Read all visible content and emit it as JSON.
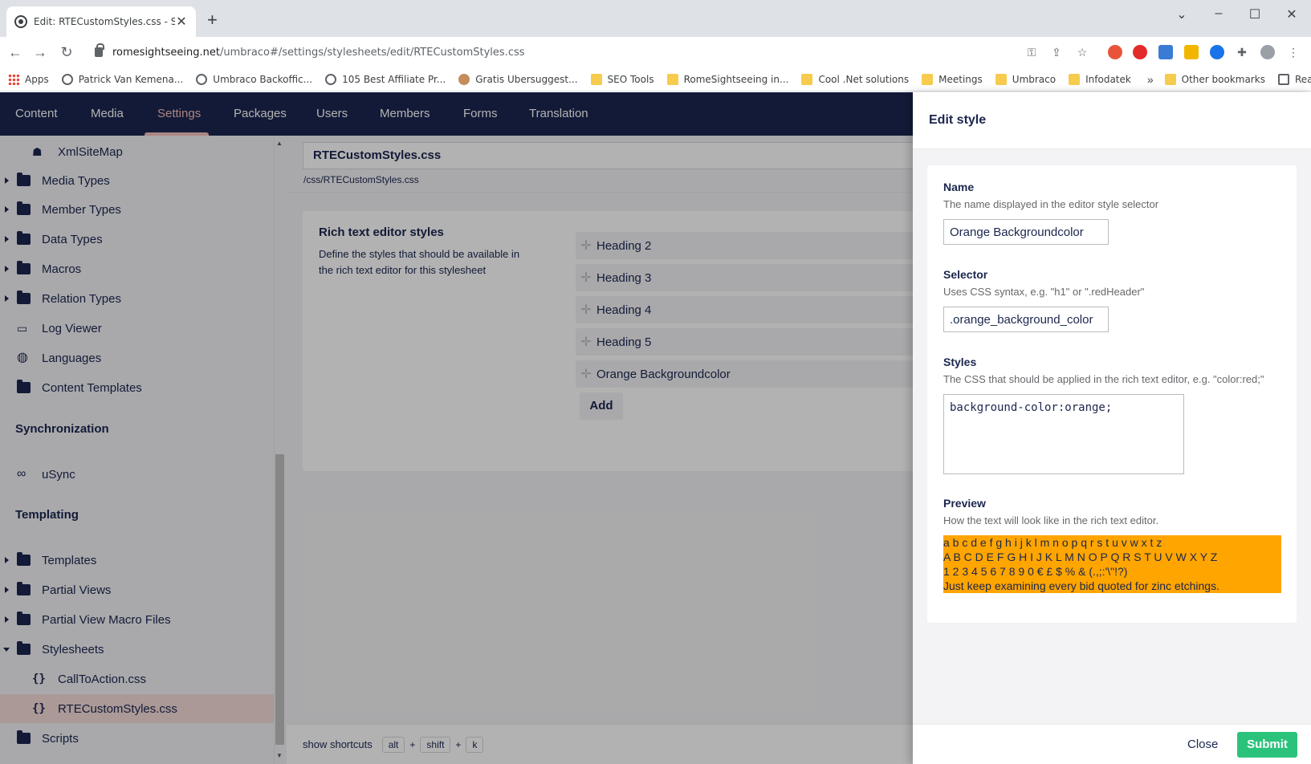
{
  "browser": {
    "tab_title": "Edit: RTECustomStyles.css - Settin",
    "url_domain": "romesightseeing.net",
    "url_path": "/umbraco#/settings/stylesheets/edit/RTECustomStyles.css",
    "bookmarks": [
      {
        "label": "Apps",
        "icon": "apps-icon"
      },
      {
        "label": "Patrick Van Kemena...",
        "icon": "globe-icon"
      },
      {
        "label": "Umbraco Backoffic...",
        "icon": "globe-icon"
      },
      {
        "label": "105 Best Affiliate Pr...",
        "icon": "globe-icon"
      },
      {
        "label": "Gratis Ubersuggest...",
        "icon": "face-icon"
      },
      {
        "label": "SEO Tools",
        "icon": "folder-icon"
      },
      {
        "label": "RomeSightseeing in...",
        "icon": "folder-icon"
      },
      {
        "label": "Cool .Net solutions",
        "icon": "folder-icon"
      },
      {
        "label": "Meetings",
        "icon": "folder-icon"
      },
      {
        "label": "Umbraco",
        "icon": "folder-icon"
      },
      {
        "label": "Infodatek",
        "icon": "folder-icon"
      }
    ],
    "more_bookmarks": "»",
    "other_bookmarks": "Other bookmarks",
    "reading_list": "Reading list"
  },
  "nav": {
    "items": [
      "Content",
      "Media",
      "Settings",
      "Packages",
      "Users",
      "Members",
      "Forms",
      "Translation"
    ],
    "active": "Settings"
  },
  "tree": {
    "items": {
      "xmlsitemap": "XmlSiteMap",
      "media_types": "Media Types",
      "member_types": "Member Types",
      "data_types": "Data Types",
      "macros": "Macros",
      "relation_types": "Relation Types",
      "log_viewer": "Log Viewer",
      "languages": "Languages",
      "content_templates": "Content Templates",
      "usync": "uSync",
      "templates": "Templates",
      "partial_views": "Partial Views",
      "partial_view_macro_files": "Partial View Macro Files",
      "stylesheets": "Stylesheets",
      "calltoaction": "CallToAction.css",
      "rtecustomstyles": "RTECustomStyles.css",
      "scripts": "Scripts"
    },
    "sections": {
      "synchronization": "Synchronization",
      "templating": "Templating"
    }
  },
  "editor": {
    "name": "RTECustomStyles.css",
    "path": "/css/RTECustomStyles.css",
    "card_title": "Rich text editor styles",
    "card_desc": "Define the styles that should be available in the rich text editor for this stylesheet",
    "styles": [
      "Heading 2",
      "Heading 3",
      "Heading 4",
      "Heading 5",
      "Orange Backgroundcolor"
    ],
    "add_label": "Add",
    "shortcuts_label": "show shortcuts",
    "keys": [
      "alt",
      "shift",
      "k"
    ]
  },
  "dialog": {
    "title": "Edit style",
    "name_label": "Name",
    "name_desc": "The name displayed in the editor style selector",
    "name_value": "Orange Backgroundcolor",
    "selector_label": "Selector",
    "selector_desc": "Uses CSS syntax, e.g. \"h1\" or \".redHeader\"",
    "selector_value": ".orange_background_color",
    "styles_label": "Styles",
    "styles_desc": "The CSS that should be applied in the rich text editor, e.g. \"color:red;\"",
    "styles_value": "background-color:orange;",
    "preview_label": "Preview",
    "preview_desc": "How the text will look like in the rich text editor.",
    "preview_lines": [
      "a b c d e f g h i j k l m n o p q r s t u v w x t z",
      "A B C D E F G H I J K L M N O P Q R S T U V W X Y Z",
      "1 2 3 4 5 6 7 8 9 0 € £ $ % & (.,;:'\\\"!?)",
      "Just keep examining every bid quoted for zinc etchings."
    ],
    "preview_color": "#ffa500",
    "close_label": "Close",
    "submit_label": "Submit",
    "submit_color": "#2bc37c"
  }
}
